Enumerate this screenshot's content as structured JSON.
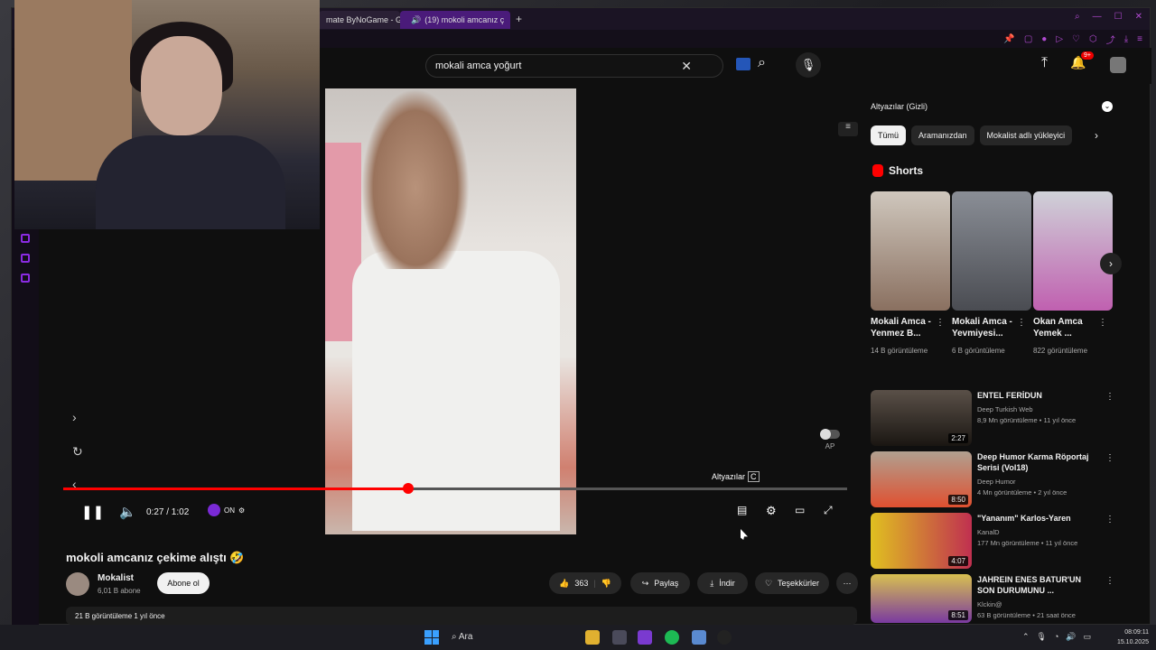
{
  "browser": {
    "tabs": [
      {
        "label": "mate ByNoGame - Gel"
      },
      {
        "label": "(19) mokoli amcanız ç"
      }
    ]
  },
  "search": {
    "value": "mokali amca yoğurt"
  },
  "header": {
    "notification_count": "9+"
  },
  "player": {
    "time": "0:27 / 1:02",
    "progress_fraction": 0.44,
    "ext_status": "ON",
    "subtitle_tooltip": "Altyazılar",
    "subtitle_key": "C",
    "autoplay_label": "AP"
  },
  "video": {
    "title": "mokoli amcanız çekime alıştı 🤣",
    "channel": "Mokalist",
    "subscribers": "6,01 B abone",
    "subscribe_label": "Abone ol",
    "likes": "363",
    "share_label": "Paylaş",
    "download_label": "İndir",
    "thanks_label": "Teşekkürler",
    "description_meta": "21 B görüntüleme  1 yıl önce"
  },
  "sidebar": {
    "subtitles_select": "Altyazılar (Gizli)",
    "chips": [
      "Tümü",
      "Aramanızdan",
      "Mokalist adlı yükleyici"
    ],
    "shorts_heading": "Shorts",
    "shorts": [
      {
        "title": "Mokali Amca - Yenmez B...",
        "views": "14 B görüntüleme"
      },
      {
        "title": "Mokali Amca - Yevmiyesi...",
        "views": "6 B görüntüleme"
      },
      {
        "title": "Okan Amca Yemek ...",
        "views": "822 görüntüleme"
      }
    ],
    "recommendations": [
      {
        "title": "ENTEL FERİDUN",
        "channel": "Deep Turkish Web",
        "meta": "8,9 Mn görüntüleme • 11 yıl önce",
        "duration": "2:27"
      },
      {
        "title": "Deep Humor Karma Röportaj Serisi (Vol18)",
        "channel": "Deep Humor",
        "meta": "4 Mn görüntüleme • 2 yıl önce",
        "duration": "8:50"
      },
      {
        "title": "\"Yananım\" Karlos-Yaren",
        "channel": "KanalD",
        "meta": "177 Mn görüntüleme • 11 yıl önce",
        "duration": "4:07"
      },
      {
        "title": "JAHREIN ENES BATUR'UN SON DURUMUNU ...",
        "channel": "Klckin@",
        "meta": "63 B görüntüleme • 21 saat önce",
        "duration": "8:51"
      }
    ]
  },
  "taskbar": {
    "search_label": "Ara",
    "time": "08:09:11",
    "date": "15.10.2025"
  }
}
